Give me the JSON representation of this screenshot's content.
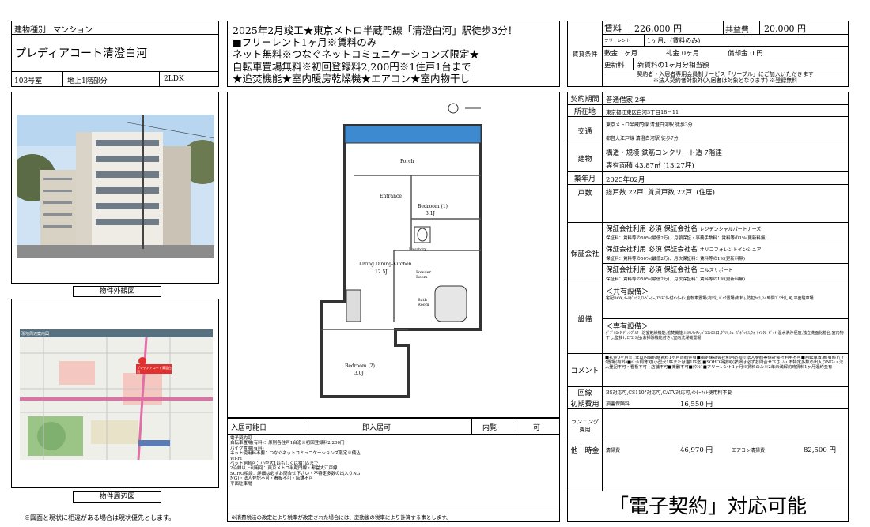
{
  "property": {
    "type_label": "建物種別",
    "type": "マンション",
    "name": "プレディアコート清澄白河",
    "room": "103号室",
    "floor": "地上1階部分",
    "layout": "2LDK"
  },
  "photos": {
    "exterior_caption": "物件外観図",
    "map_caption": "物件周辺図",
    "map_title": "現地周辺案内図",
    "map_pin": "プレディアコート清澄白河",
    "note": "※図面と現状に相違がある場合は現状優先とします。"
  },
  "headline": {
    "line1": "2025年2月竣工★東京メトロ半蔵門線「清澄白河」駅徒歩3分！",
    "line2": "■フリーレント1ヶ月※賃料のみ",
    "line3": "ネット無料※つなぐネットコミュニケーションズ限定★",
    "line4": "自転車置場無料※初回登録料2,200円※1住戸1台まで",
    "line5": "★追焚機能★室内暖房乾燥機★エアコン★室内物干し"
  },
  "floorplan": {
    "porch": "Porch",
    "entrance": "Entrance",
    "bedroom1": "Bedroom (1)",
    "bedroom1_size": "3.1J",
    "ldk": "Living Dining-Kitchen",
    "ldk_size": "12.5J",
    "powder": "Powder Room",
    "bath": "Bath Room",
    "lavatory": "Lavatory",
    "bedroom2": "Bedroom (2)",
    "bedroom2_size": "3.0J",
    "laundry": "laundry"
  },
  "movein": {
    "label": "入居可能日",
    "value": "即入居可",
    "viewing_label": "内覧",
    "viewing_value": "可",
    "notes": [
      "電子契約可",
      "自転車置場(有料)：原則各住戸1台迄※初回登録料2,200円",
      "バイク置場(有料)",
      "ネット使用料不要：つなぐネットコミュニケーションズ限定※備込",
      "Wi-Fi",
      "ペット飼育可：小型犬1匹もしくは猫1匹まで",
      "2沿線以上利用可：東京メトロ半蔵門線・都営大江戸線",
      "SOHO相談：詳細は必ずお問合せ下さい・不特定多数の出入りNG",
      "NG)・法人登記不可・看板不可・店舗不可",
      "平面駐車場"
    ],
    "tax_note": "※消費税法の改定により税率が改定された場合には、変動後の税率により計算する事とします。"
  },
  "conditions": {
    "label": "賃貸条件",
    "rent_label": "賃料",
    "rent": "226,000 円",
    "common_label": "共益費",
    "common": "20,000 円",
    "freerent_label": "フリーレント",
    "freerent": "1ヶ月、(賃料のみ)",
    "deposit": "敷金 1ヶ月",
    "keymoney": "礼金 0ヶ月",
    "amortization": "償却金 0 円",
    "renewal_label": "更新料",
    "renewal": "新賃料の1ヶ月分相当額",
    "service_note1": "契約者・入居者専用会員制サービス「リーブル」にご加入いただきます",
    "service_note2": "※法人契約者対象外(入居者は対象となります) ※登録無料"
  },
  "details": {
    "contract_label": "契約期間",
    "contract": "普通借家 2年",
    "address_label": "所在地",
    "address": "東京都江東区白河3丁目18－11",
    "transport_label": "交通",
    "transport1": "東京メトロ半蔵門線 清澄白河駅 徒歩3分",
    "transport2": "都営大江戸線 清澄白河駅 徒歩7分",
    "building_label": "建物",
    "structure": "構造・規模 鉄筋コンクリート造 7階建",
    "area": "専有面積 43.87㎡ (13.27坪)",
    "built_label": "築年月",
    "built": "2025年02月",
    "units_label": "戸数",
    "units": "総戸数 22戸  賃貸戸数 22戸  (住居)",
    "guarantor_label": "保証会社",
    "guarantors": [
      {
        "head": "保証会社利用 必須 保証会社名",
        "company": "レジデンシャルパートナーズ",
        "detail": "保証料：賃料等の50%(最低2万)、月額保証・事務手数料：賃料等の1%(更新料無)"
      },
      {
        "head": "保証会社利用 必須 保証会社名",
        "company": "オリコフォレントインシュア",
        "detail": "保証料：賃料等の50%(最低2万)、月次保証料：賃料等の1%(更新料無)"
      },
      {
        "head": "保証会社利用 必須 保証会社名",
        "company": "エルズサポート",
        "detail": "保証料：賃料等の50%(最低2万)、月次保証料：賃料等の1%(更新料無)"
      }
    ],
    "equipment_label": "設備",
    "common_eq_title": "＜共有設備＞",
    "common_eq": "宅配BOX,ﾒｰﾙﾎﾞｯｸｽ,ｴﾚﾍﾞｰﾀｰ,TVﾓﾆﾀｰ付ｲﾝﾀｰﾎﾝ,自転車置場(有料),ﾊﾞｲｸ置場(有料),防犯ｶﾒﾗ,24時間ｺﾞﾐ出し可,平面駐車場",
    "private_eq_title": "＜専有設備＞",
    "private_eq": "ﾀﾞﾌﾞﾙﾛｯｸ,ﾃﾞｨﾝﾌﾟﾙｷｰ,浴室乾燥機能,追焚機能,ｼｽﾃﾑｷｯﾁﾝ,ｶﾞｽｺﾝﾛ3口,ｸﾞﾘﾙ,ｼｭｰｽﾞﾎﾞｯｸｽ,ｳｫｰｸｲﾝｸﾛｰｾﾞｯﾄ,温水洗浄便座,独立洗面化粧台,室内物干し,壁掛けｴｱｺﾝ3台(お掃除機能付き),室内洗濯機置場",
    "comment_label": "コメント",
    "comment": "■礼金0ヶ月※1年以内解約時賃料1ヶ月違約金有■指定保証会社利用必須※法人契約等保証会社利用不可■自転車置場(有料)ﾊﾞｲｸ置場(有料)■ﾍﾟｯﾄ飼育可(小型犬1匹または猫1匹迄)■SOHO相談可(詳細は必ずお問合せ下さい・不特定多数の出入りNG)・法人登記不可・看板不可・店舗不可■楽器不可■ﾗｳﾝｼﾞ■フリーレント1ヶ月※賃料のみ※2年未満解約時賃料1ヶ月違約金有",
    "line_label": "回線",
    "line": "BS対応可,CS110°対応可,CATV対応可,ｲﾝﾀｰﾈｯﾄ使用料不要",
    "initial_label": "初期費用",
    "initial_item": "損害保険料",
    "initial_value": "16,550 円",
    "running_label": "ランニング費用",
    "onetime_label": "他一時金",
    "clean_label": "清掃費",
    "clean_value": "46,970 円",
    "ac_label": "エアコン清掃費",
    "ac_value": "82,500 円",
    "econtract": "「電子契約」対応可能"
  }
}
